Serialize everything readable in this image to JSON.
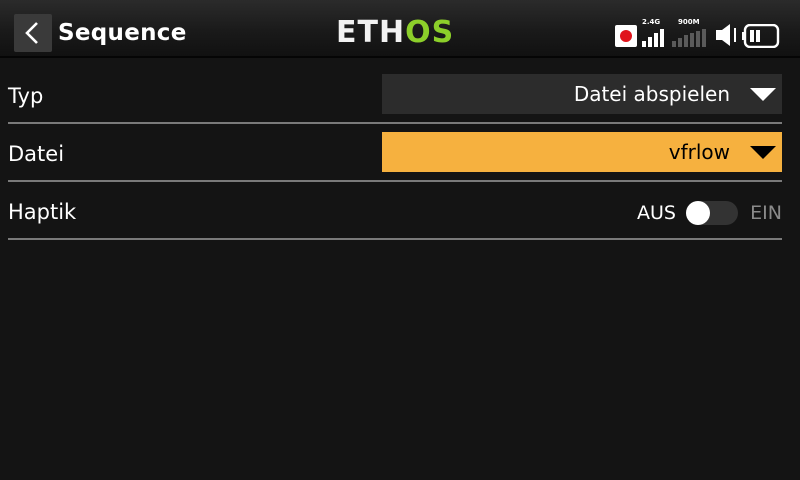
{
  "header": {
    "title": "Sequence",
    "logo": {
      "part1": "ETH",
      "part2": "OS",
      "color_main": "#f2f2f2",
      "color_accent": "#8ccf2a"
    },
    "status": {
      "signal_24": {
        "label": "2.4G",
        "bars_active": 4,
        "bars_total": 4
      },
      "signal_900": {
        "label": "900M",
        "bars_active": 0,
        "bars_total": 4
      },
      "icons": [
        "record-icon",
        "speaker-mute-icon",
        "battery-icon"
      ]
    }
  },
  "rows": [
    {
      "label": "Typ",
      "value": "Datei abspielen"
    },
    {
      "label": "Datei",
      "value": "vfrlow"
    },
    {
      "label": "Haptik",
      "off_label": "AUS",
      "on_label": "EIN",
      "state": "off"
    }
  ],
  "colors": {
    "accent": "#f6b13f",
    "background": "#141414",
    "field": "#2c2c2c"
  }
}
